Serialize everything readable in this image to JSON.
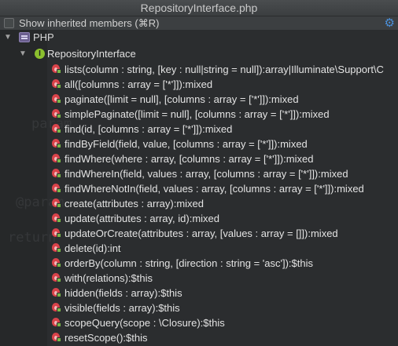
{
  "window": {
    "title": "RepositoryInterface.php"
  },
  "toolbar": {
    "checkbox_label": "Show inherited members (⌘R)",
    "checkbox_checked": false
  },
  "tree": {
    "root": {
      "label": "PHP",
      "expanded": true
    },
    "interface": {
      "label": "RepositoryInterface",
      "expanded": true
    },
    "methods": [
      "lists(column : string, [key : null|string = null]):array|Illuminate\\Support\\C",
      "all([columns : array = ['*']]):mixed",
      "paginate([limit = null], [columns : array = ['*']]):mixed",
      "simplePaginate([limit = null], [columns : array = ['*']]):mixed",
      "find(id, [columns : array = ['*']]):mixed",
      "findByField(field, value, [columns : array = ['*']]):mixed",
      "findWhere(where : array, [columns : array = ['*']]):mixed",
      "findWhereIn(field, values : array, [columns : array = ['*']]):mixed",
      "findWhereNotIn(field, values : array, [columns : array = ['*']]):mixed",
      "create(attributes : array):mixed",
      "update(attributes : array, id):mixed",
      "updateOrCreate(attributes : array, [values : array = []]):mixed",
      "delete(id):int",
      "orderBy(column : string, [direction : string = 'asc']):$this",
      "with(relations):$this",
      "hidden(fields : array):$this",
      "visible(fields : array):$this",
      "scopeQuery(scope : \\Closure):$this",
      "resetScope():$this"
    ]
  },
  "colors": {
    "accent": "#4a8fd9",
    "interface_icon": "#8bbf2e",
    "method_icon": "#d9434a",
    "lock": "#7ab648"
  }
}
